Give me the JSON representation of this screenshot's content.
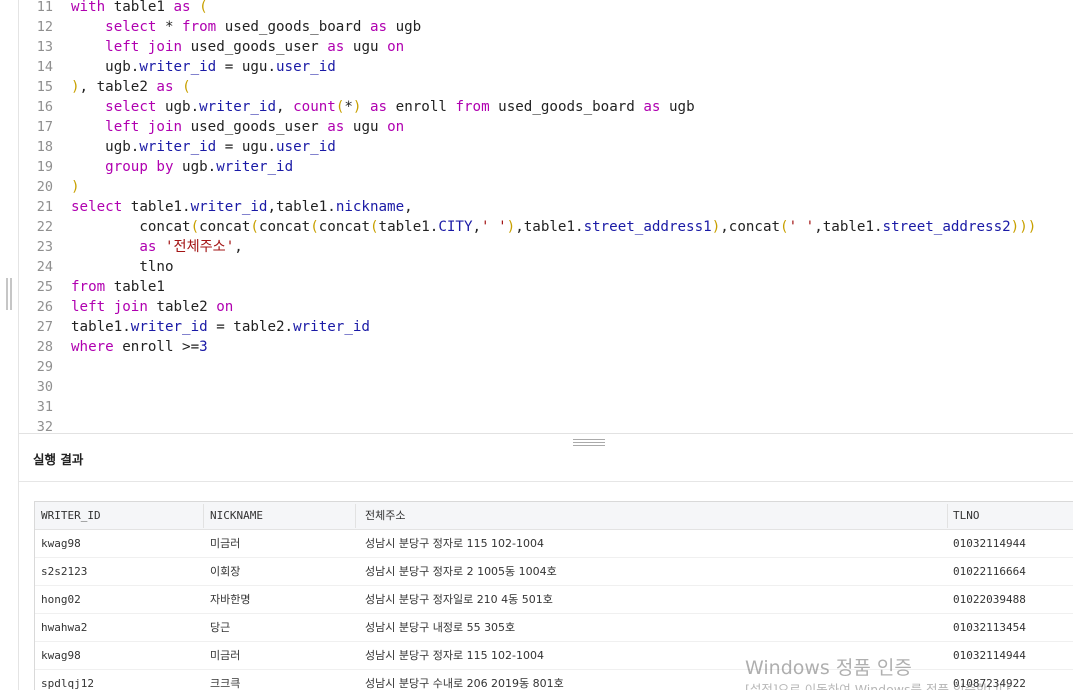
{
  "editor": {
    "lines": [
      {
        "n": "11",
        "tokens": [
          [
            "kw",
            "with"
          ],
          [
            "id",
            " table1 "
          ],
          [
            "kw",
            "as"
          ],
          [
            "id",
            " "
          ],
          [
            "par",
            "("
          ]
        ]
      },
      {
        "n": "12",
        "tokens": [
          [
            "id",
            "    "
          ],
          [
            "kw",
            "select"
          ],
          [
            "id",
            " * "
          ],
          [
            "kw",
            "from"
          ],
          [
            "id",
            " used_goods_board "
          ],
          [
            "kw",
            "as"
          ],
          [
            "id",
            " ugb"
          ]
        ]
      },
      {
        "n": "13",
        "tokens": [
          [
            "id",
            "    "
          ],
          [
            "kw",
            "left join"
          ],
          [
            "id",
            " used_goods_user "
          ],
          [
            "kw",
            "as"
          ],
          [
            "id",
            " ugu "
          ],
          [
            "kw",
            "on"
          ]
        ]
      },
      {
        "n": "14",
        "tokens": [
          [
            "id",
            "    ugb."
          ],
          [
            "prop",
            "writer_id"
          ],
          [
            "id",
            " = ugu."
          ],
          [
            "prop",
            "user_id"
          ]
        ]
      },
      {
        "n": "15",
        "tokens": [
          [
            "par",
            ")"
          ],
          [
            "id",
            ", table2 "
          ],
          [
            "kw",
            "as"
          ],
          [
            "id",
            " "
          ],
          [
            "par",
            "("
          ]
        ]
      },
      {
        "n": "16",
        "tokens": [
          [
            "id",
            "    "
          ],
          [
            "kw",
            "select"
          ],
          [
            "id",
            " ugb."
          ],
          [
            "prop",
            "writer_id"
          ],
          [
            "id",
            ", "
          ],
          [
            "fn",
            "count"
          ],
          [
            "par",
            "("
          ],
          [
            "id",
            "*"
          ],
          [
            "par",
            ")"
          ],
          [
            "id",
            " "
          ],
          [
            "kw",
            "as"
          ],
          [
            "id",
            " enroll "
          ],
          [
            "kw",
            "from"
          ],
          [
            "id",
            " used_goods_board "
          ],
          [
            "kw",
            "as"
          ],
          [
            "id",
            " ugb"
          ]
        ]
      },
      {
        "n": "17",
        "tokens": [
          [
            "id",
            "    "
          ],
          [
            "kw",
            "left join"
          ],
          [
            "id",
            " used_goods_user "
          ],
          [
            "kw",
            "as"
          ],
          [
            "id",
            " ugu "
          ],
          [
            "kw",
            "on"
          ]
        ]
      },
      {
        "n": "18",
        "tokens": [
          [
            "id",
            "    ugb."
          ],
          [
            "prop",
            "writer_id"
          ],
          [
            "id",
            " = ugu."
          ],
          [
            "prop",
            "user_id"
          ]
        ]
      },
      {
        "n": "19",
        "tokens": [
          [
            "id",
            "    "
          ],
          [
            "kw",
            "group by"
          ],
          [
            "id",
            " ugb."
          ],
          [
            "prop",
            "writer_id"
          ]
        ]
      },
      {
        "n": "20",
        "tokens": [
          [
            "par",
            ")"
          ]
        ]
      },
      {
        "n": "21",
        "tokens": [
          [
            "kw",
            "select"
          ],
          [
            "id",
            " table1."
          ],
          [
            "prop",
            "writer_id"
          ],
          [
            "id",
            ",table1."
          ],
          [
            "prop",
            "nickname"
          ],
          [
            "id",
            ","
          ]
        ]
      },
      {
        "n": "22",
        "tokens": [
          [
            "id",
            "        concat"
          ],
          [
            "par",
            "("
          ],
          [
            "id",
            "concat"
          ],
          [
            "par",
            "("
          ],
          [
            "id",
            "concat"
          ],
          [
            "par",
            "("
          ],
          [
            "id",
            "concat"
          ],
          [
            "par",
            "("
          ],
          [
            "id",
            "table1."
          ],
          [
            "prop",
            "CITY"
          ],
          [
            "id",
            ","
          ],
          [
            "str",
            "' '"
          ],
          [
            "par",
            ")"
          ],
          [
            "id",
            ",table1."
          ],
          [
            "prop",
            "street_address1"
          ],
          [
            "par",
            ")"
          ],
          [
            "id",
            ",concat"
          ],
          [
            "par",
            "("
          ],
          [
            "str",
            "' '"
          ],
          [
            "id",
            ",table1."
          ],
          [
            "prop",
            "street_address2"
          ],
          [
            "par",
            ")))"
          ]
        ]
      },
      {
        "n": "23",
        "tokens": [
          [
            "id",
            "        "
          ],
          [
            "kw",
            "as"
          ],
          [
            "id",
            " "
          ],
          [
            "str",
            "'전체주소'"
          ],
          [
            "id",
            ","
          ]
        ]
      },
      {
        "n": "24",
        "tokens": [
          [
            "id",
            "        tlno"
          ]
        ]
      },
      {
        "n": "25",
        "tokens": [
          [
            "kw",
            "from"
          ],
          [
            "id",
            " table1"
          ]
        ]
      },
      {
        "n": "26",
        "tokens": [
          [
            "kw",
            "left join"
          ],
          [
            "id",
            " table2 "
          ],
          [
            "kw",
            "on"
          ]
        ]
      },
      {
        "n": "27",
        "tokens": [
          [
            "id",
            "table1."
          ],
          [
            "prop",
            "writer_id"
          ],
          [
            "id",
            " = table2."
          ],
          [
            "prop",
            "writer_id"
          ]
        ]
      },
      {
        "n": "28",
        "tokens": [
          [
            "kw",
            "where"
          ],
          [
            "id",
            " enroll >="
          ],
          [
            "prop",
            "3"
          ]
        ]
      },
      {
        "n": "29",
        "tokens": []
      },
      {
        "n": "30",
        "tokens": []
      },
      {
        "n": "31",
        "tokens": []
      },
      {
        "n": "32",
        "tokens": []
      }
    ]
  },
  "results": {
    "title": "실행 결과",
    "columns": [
      "WRITER_ID",
      "NICKNAME",
      "전체주소",
      "TLNO"
    ],
    "rows": [
      [
        "kwag98",
        "미금러",
        "성남시 분당구 정자로 115 102-1004",
        "01032114944"
      ],
      [
        "s2s2123",
        "이회장",
        "성남시 분당구 정자로 2 1005동 1004호",
        "01022116664"
      ],
      [
        "hong02",
        "자바한명",
        "성남시 분당구 정자일로 210 4동 501호",
        "01022039488"
      ],
      [
        "hwahwa2",
        "당근",
        "성남시 분당구 내정로 55 305호",
        "01032113454"
      ],
      [
        "kwag98",
        "미금러",
        "성남시 분당구 정자로 115 102-1004",
        "01032114944"
      ],
      [
        "spdlqj12",
        "크크큭",
        "성남시 분당구 수내로 206 2019동 801호",
        "01087234922"
      ]
    ]
  },
  "watermark": {
    "line1": "Windows 정품 인증",
    "line2": "[설정]으로 이동하여 Windows를 정품 인증합니다."
  }
}
